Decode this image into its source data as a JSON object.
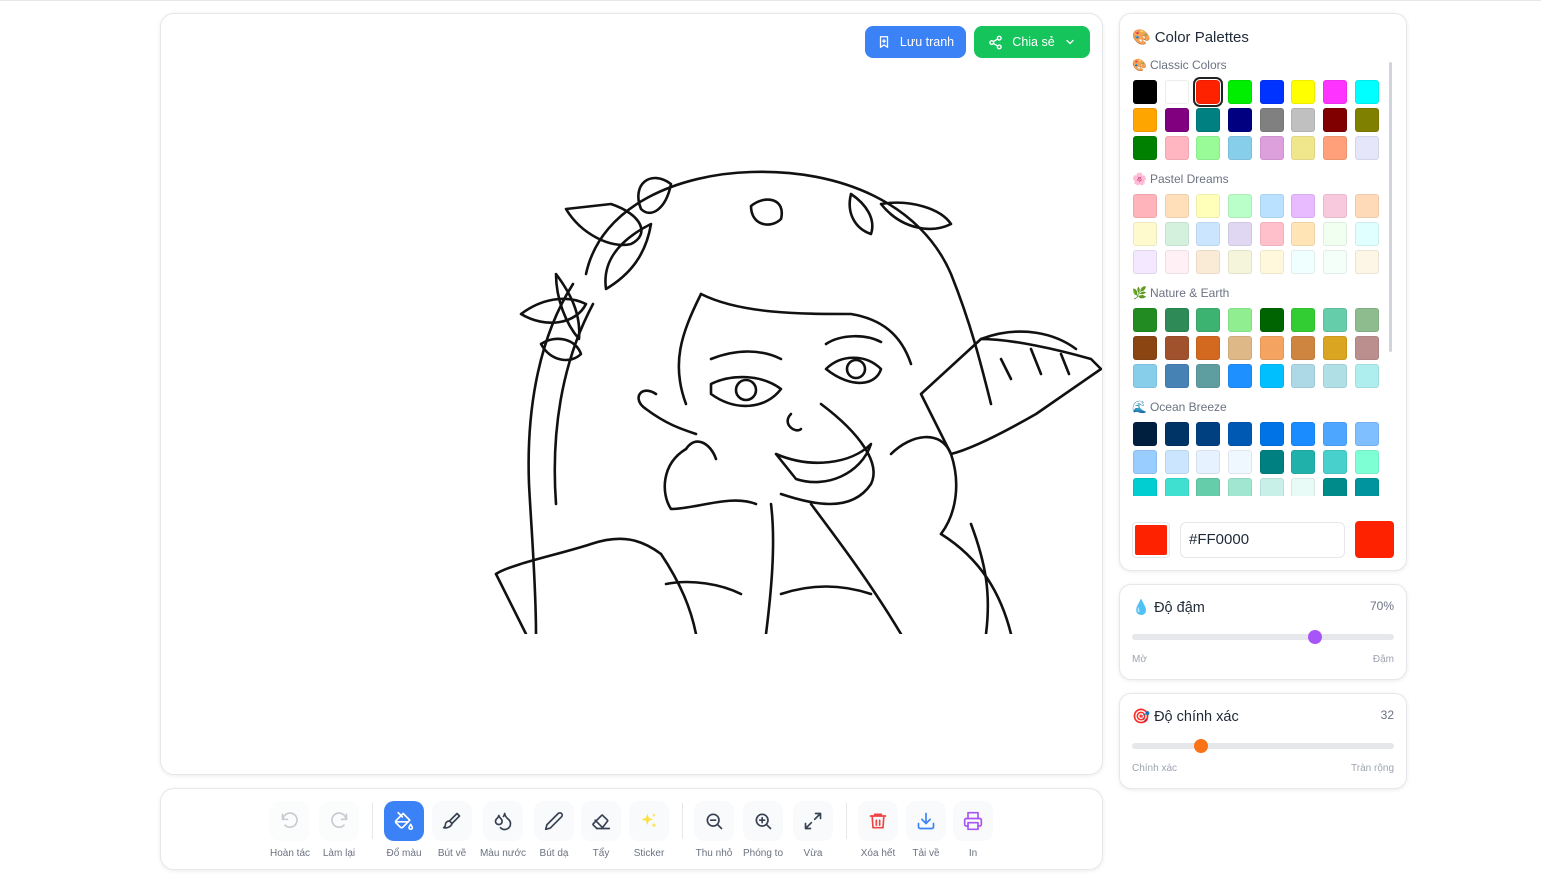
{
  "actions": {
    "save_label": "Lưu tranh",
    "share_label": "Chia sẻ"
  },
  "toolbar": {
    "tools": [
      {
        "id": "undo",
        "label": "Hoàn tác",
        "icon": "undo-icon",
        "enabled": false
      },
      {
        "id": "redo",
        "label": "Làm lại",
        "icon": "redo-icon",
        "enabled": false
      },
      {
        "id": "fill",
        "label": "Đổ màu",
        "icon": "paint-bucket-icon",
        "active": true
      },
      {
        "id": "brush",
        "label": "Bút vẽ",
        "icon": "brush-icon"
      },
      {
        "id": "watercolor",
        "label": "Màu nước",
        "icon": "droplets-icon"
      },
      {
        "id": "pencil",
        "label": "Bút dạ",
        "icon": "pencil-icon"
      },
      {
        "id": "eraser",
        "label": "Tẩy",
        "icon": "eraser-icon"
      },
      {
        "id": "sticker",
        "label": "Sticker",
        "icon": "sparkles-icon"
      },
      {
        "id": "zoom-out",
        "label": "Thu nhỏ",
        "icon": "zoom-out-icon"
      },
      {
        "id": "zoom-in",
        "label": "Phóng to",
        "icon": "zoom-in-icon"
      },
      {
        "id": "fit",
        "label": "Vừa",
        "icon": "expand-icon"
      },
      {
        "id": "clear",
        "label": "Xóa hết",
        "icon": "trash-icon"
      },
      {
        "id": "download",
        "label": "Tải về",
        "icon": "download-icon"
      },
      {
        "id": "print",
        "label": "In",
        "icon": "printer-icon"
      }
    ]
  },
  "palettes": {
    "title": "Color Palettes",
    "title_icon": "palette-icon",
    "groups": [
      {
        "name": "Classic Colors",
        "icon": "palette-icon",
        "colors": [
          "#000000",
          "#FFFFFF",
          "#FF2200",
          "#00EE00",
          "#0033FF",
          "#FFFF00",
          "#FF33FF",
          "#00FFFF",
          "#FFA500",
          "#800080",
          "#008080",
          "#000080",
          "#808080",
          "#C0C0C0",
          "#800000",
          "#808000",
          "#008000",
          "#FFB6C1",
          "#98FB98",
          "#87CEEB",
          "#DDA0DD",
          "#F0E68C",
          "#FFA07A",
          "#E6E6FA"
        ]
      },
      {
        "name": "Pastel Dreams",
        "icon": "cherry-blossom-icon",
        "colors": [
          "#FFB3BA",
          "#FFDFBA",
          "#FFFFBA",
          "#BAFFC9",
          "#BAE1FF",
          "#E8BAFF",
          "#F8C8DC",
          "#FFDAB9",
          "#FFFACD",
          "#D4F1DE",
          "#CCE5FF",
          "#E0D7F2",
          "#FFC0CB",
          "#FFE4B5",
          "#F0FFF0",
          "#E0FFFF",
          "#F3E8FF",
          "#FFF0F5",
          "#FAEBD7",
          "#F5F5DC",
          "#FFF8DC",
          "#F0FFFF",
          "#F5FFFA",
          "#FDF5E6"
        ]
      },
      {
        "name": "Nature & Earth",
        "icon": "herb-icon",
        "colors": [
          "#228B22",
          "#2E8B57",
          "#3CB371",
          "#90EE90",
          "#006400",
          "#32CD32",
          "#66CDAA",
          "#8FBC8F",
          "#8B4513",
          "#A0522D",
          "#D2691E",
          "#DEB887",
          "#F4A460",
          "#CD853F",
          "#DAA520",
          "#BC8F8F",
          "#87CEEB",
          "#4682B4",
          "#5F9EA0",
          "#1E90FF",
          "#00BFFF",
          "#ADD8E6",
          "#B0E0E6",
          "#AFEEEE"
        ]
      },
      {
        "name": "Ocean Breeze",
        "icon": "wave-icon",
        "colors": [
          "#001F3F",
          "#003366",
          "#004080",
          "#0059B3",
          "#0073E6",
          "#1A8CFF",
          "#4DA6FF",
          "#80BFFF",
          "#99CCFF",
          "#CCE5FF",
          "#E6F2FF",
          "#F0F8FF",
          "#008080",
          "#20B2AA",
          "#48D1CC",
          "#7FFFD4",
          "#00CED1",
          "#40E0D0",
          "#66CDAA",
          "#A0E6D0",
          "#C8F0E8",
          "#E8FBF6",
          "#008B8B",
          "#00959E"
        ]
      }
    ],
    "selected_color": "#FF2200",
    "hex_value": "#FF0000"
  },
  "opacity": {
    "label": "Độ đậm",
    "icon": "droplet-icon",
    "value_text": "70%",
    "value": 0.7,
    "min_label": "Mờ",
    "max_label": "Đậm",
    "thumb_color": "#a855f7"
  },
  "tolerance": {
    "label": "Độ chính xác",
    "icon": "target-icon",
    "value_text": "32",
    "value": 0.265,
    "min_label": "Chính xác",
    "max_label": "Tràn rộng",
    "thumb_color": "#f97316"
  }
}
